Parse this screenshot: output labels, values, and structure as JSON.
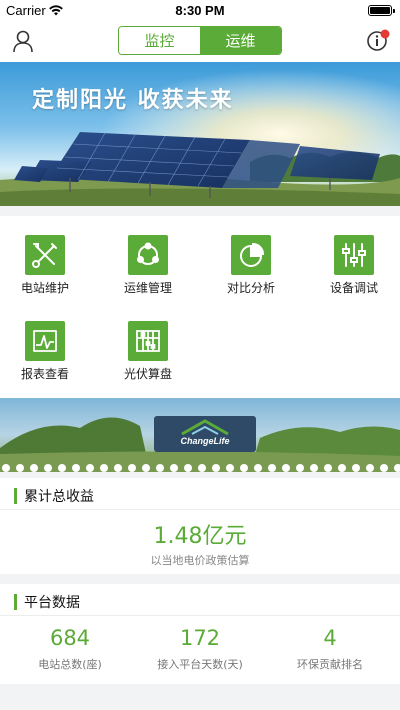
{
  "status_bar": {
    "carrier": "Carrier",
    "time": "8:30 PM"
  },
  "nav": {
    "segments": [
      "监控",
      "运维"
    ],
    "active_segment": "运维",
    "icons": [
      "user-icon",
      "info-icon",
      "notification-dot"
    ]
  },
  "banner": {
    "title": "定制阳光  收获未来"
  },
  "tools": [
    {
      "label": "电站维护",
      "icon": "tools-icon"
    },
    {
      "label": "运维管理",
      "icon": "cycle-icon"
    },
    {
      "label": "对比分析",
      "icon": "pie-chart-icon"
    },
    {
      "label": "设备调试",
      "icon": "sliders-icon"
    },
    {
      "label": "报表查看",
      "icon": "line-chart-icon"
    },
    {
      "label": "光伏算盘",
      "icon": "abacus-icon"
    }
  ],
  "mid_banner": {
    "logo_text": "ChangeLife"
  },
  "earnings": {
    "title": "累计总收益",
    "value": "1.48亿元",
    "note": "以当地电价政策估算"
  },
  "platform": {
    "title": "平台数据",
    "stats": [
      {
        "value": "684",
        "caption": "电站总数(座)"
      },
      {
        "value": "172",
        "caption": "接入平台天数(天)"
      },
      {
        "value": "4",
        "caption": "环保贡献排名"
      }
    ]
  },
  "colors": {
    "accent": "#5aab37",
    "badge": "#e53935",
    "background": "#f2f3f5"
  }
}
